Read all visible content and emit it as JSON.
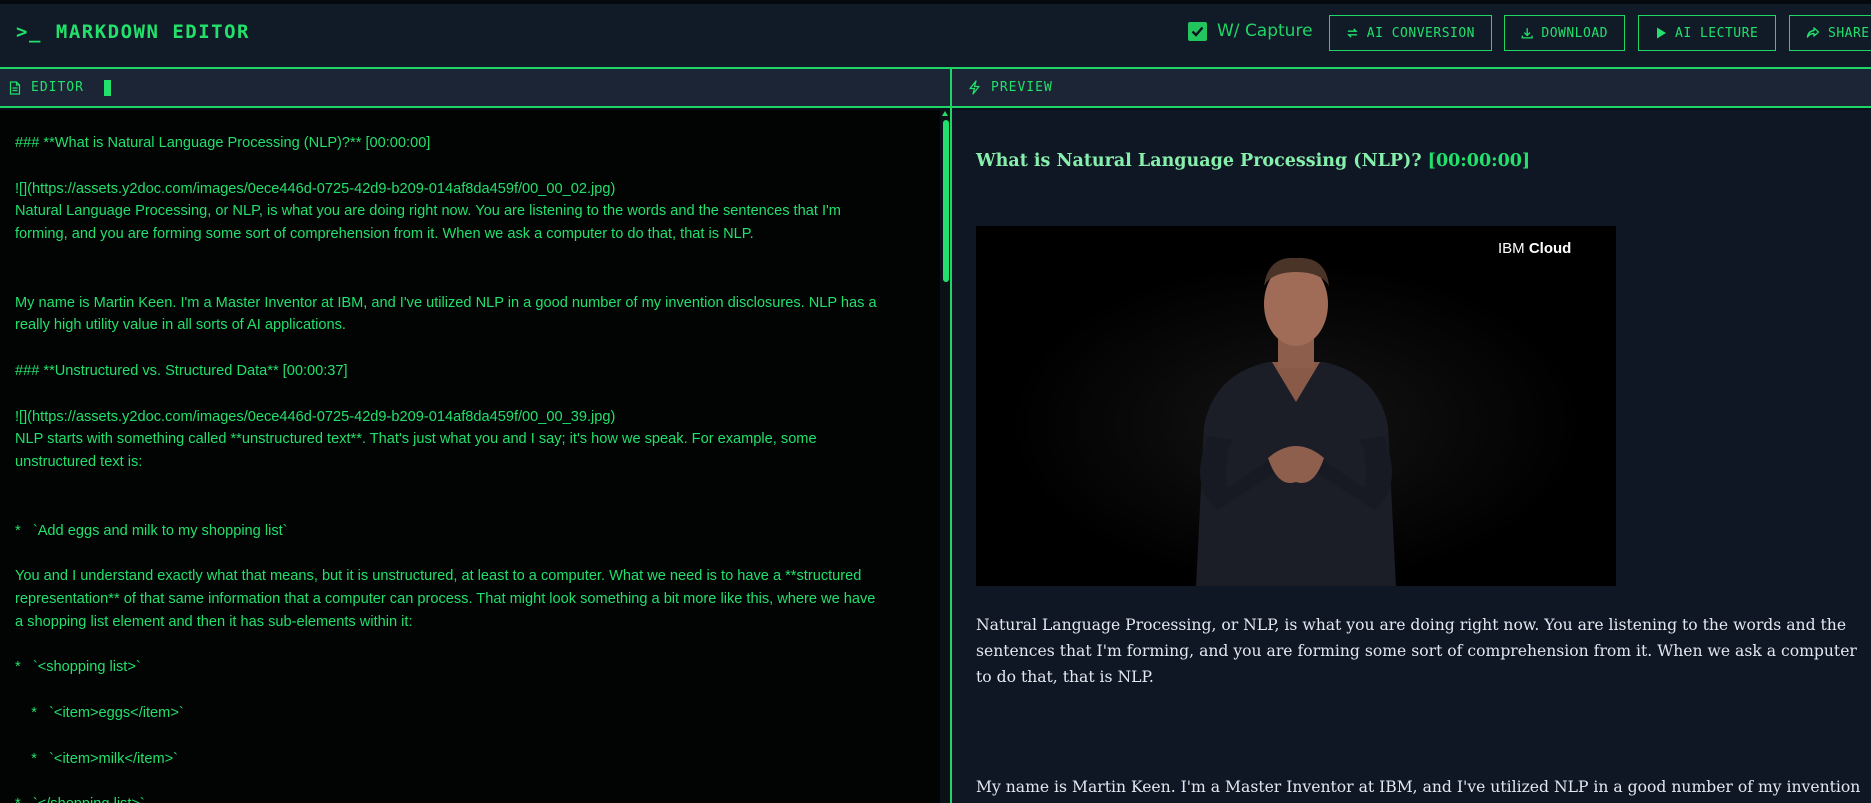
{
  "header": {
    "prompt_icon": ">_",
    "title": "MARKDOWN EDITOR",
    "capture_label": "W/ Capture",
    "capture_checked": true,
    "buttons": {
      "ai_conversion": "AI CONVERSION",
      "download": "DOWNLOAD",
      "ai_lecture": "AI LECTURE",
      "share": "SHARE"
    }
  },
  "editor": {
    "header_label": "EDITOR",
    "lines": [
      "### **What is Natural Language Processing (NLP)?** [00:00:00]",
      "",
      "![](https://assets.y2doc.com/images/0ece446d-0725-42d9-b209-014af8da459f/00_00_02.jpg)",
      "Natural Language Processing, or NLP, is what you are doing right now. You are listening to the words and the sentences that I'm",
      "forming, and you are forming some sort of comprehension from it. When we ask a computer to do that, that is NLP.",
      "",
      "",
      "My name is Martin Keen. I'm a Master Inventor at IBM, and I've utilized NLP in a good number of my invention disclosures. NLP has a",
      "really high utility value in all sorts of AI applications.",
      "",
      "### **Unstructured vs. Structured Data** [00:00:37]",
      "",
      "![](https://assets.y2doc.com/images/0ece446d-0725-42d9-b209-014af8da459f/00_00_39.jpg)",
      "NLP starts with something called **unstructured text**. That's just what you and I say; it's how we speak. For example, some",
      "unstructured text is:",
      "",
      "",
      "*   `Add eggs and milk to my shopping list`",
      "",
      "You and I understand exactly what that means, but it is unstructured, at least to a computer. What we need is to have a **structured",
      "representation** of that same information that a computer can process. That might look something a bit more like this, where we have",
      "a shopping list element and then it has sub-elements within it:",
      "",
      "*   `<shopping list>`",
      "",
      "    *   `<item>eggs</item>`",
      "",
      "    *   `<item>milk</item>`",
      "",
      "*   `</shopping list>`"
    ]
  },
  "preview": {
    "header_label": "PREVIEW",
    "heading": "What is Natural Language Processing (NLP)?",
    "heading_timestamp": "[00:00:00]",
    "video_watermark_plain": "IBM",
    "video_watermark_bold": "Cloud",
    "paragraph1": "Natural Language Processing, or NLP, is what you are doing right now. You are listening to the words and the sentences that I'm forming, and you are forming some sort of comprehension from it. When we ask a computer to do that, that is NLP.",
    "paragraph2": "My name is Martin Keen. I'm a Master Inventor at IBM, and I've utilized NLP in a good number of my invention"
  },
  "colors": {
    "accent": "#22e06b",
    "background": "#0b111c",
    "editor_bg": "#020303",
    "preview_bg": "#0f1724"
  }
}
